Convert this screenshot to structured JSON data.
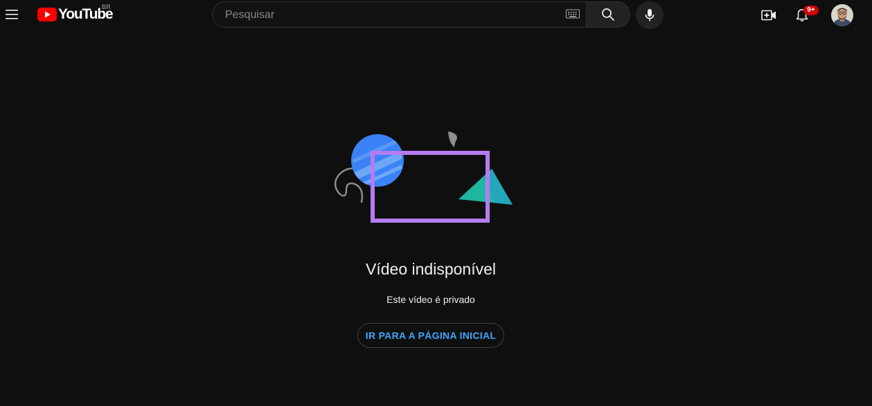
{
  "header": {
    "logo_text": "YouTube",
    "region": "BR",
    "search_placeholder": "Pesquisar",
    "notification_count": "9+"
  },
  "icons": {
    "menu": "hamburger-menu-icon",
    "logo": "youtube-play-logo-icon",
    "keyboard": "keyboard-icon",
    "search": "search-icon",
    "mic": "microphone-icon",
    "create": "create-video-icon",
    "notifications": "bell-icon",
    "avatar": "user-avatar"
  },
  "main": {
    "title": "Vídeo indisponível",
    "message": "Este vídeo é privado",
    "home_button": "IR PARA A PÁGINA INICIAL"
  },
  "colors": {
    "background": "#0f0f0f",
    "brand_red": "#ff0000",
    "link_blue": "#3ea6ff",
    "badge_red": "#cc0000",
    "illustration_purple": "#b57bf2",
    "illustration_blue": "#3b82f6",
    "illustration_teal": "#1fb6a0"
  }
}
